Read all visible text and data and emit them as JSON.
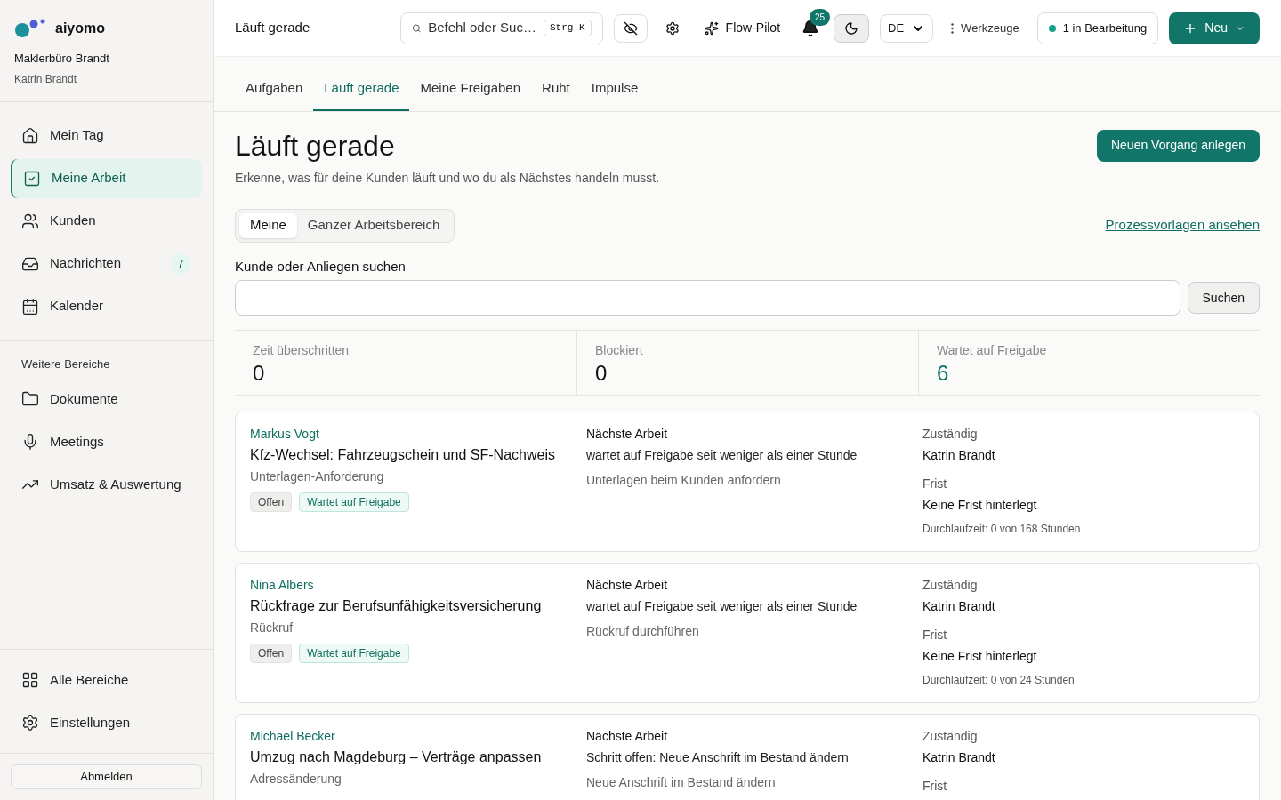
{
  "brand": {
    "name": "aiyomo",
    "office": "Maklerbüro Brandt",
    "user": "Katrin Brandt"
  },
  "nav": [
    {
      "kind": "home",
      "label": "Mein Tag",
      "selected": false
    },
    {
      "kind": "check",
      "label": "Meine Arbeit",
      "selected": true
    },
    {
      "kind": "users",
      "label": "Kunden",
      "selected": false
    },
    {
      "kind": "inbox",
      "label": "Nachrichten",
      "selected": false,
      "badge": "7"
    },
    {
      "kind": "calendar",
      "label": "Kalender",
      "selected": false
    }
  ],
  "more_title": "Weitere Bereiche",
  "more_nav": [
    {
      "kind": "folder",
      "label": "Dokumente",
      "selected": false
    },
    {
      "kind": "mic",
      "label": "Meetings",
      "selected": false
    },
    {
      "kind": "trend",
      "label": "Umsatz & Auswertung",
      "selected": false
    }
  ],
  "bottom_nav": [
    {
      "kind": "grid",
      "label": "Alle Bereiche"
    },
    {
      "kind": "gear",
      "label": "Einstellungen"
    }
  ],
  "logout": "Abmelden",
  "topbar": {
    "title": "Läuft gerade",
    "search_placeholder": "Befehl oder Suc…",
    "shortcut": "Strg K",
    "pilot": "Flow-Pilot",
    "notifications": "25",
    "language": "DE",
    "tools": "Werkzeuge",
    "status": "1 in Bearbeitung",
    "new": "Neu"
  },
  "tabs": [
    {
      "label": "Aufgaben",
      "selected": false
    },
    {
      "label": "Läuft gerade",
      "selected": true
    },
    {
      "label": "Meine Freigaben",
      "selected": false
    },
    {
      "label": "Ruht",
      "selected": false
    },
    {
      "label": "Impulse",
      "selected": false
    }
  ],
  "page": {
    "title": "Läuft gerade",
    "subtitle": "Erkenne, was für deine Kunden läuft und wo du als Nächstes handeln musst.",
    "action": "Neuen Vorgang anlegen",
    "templates_link": "Prozessvorlagen ansehen"
  },
  "scope": [
    {
      "label": "Meine",
      "selected": true
    },
    {
      "label": "Ganzer Arbeitsbereich",
      "selected": false
    }
  ],
  "search": {
    "label": "Kunde oder Anliegen suchen",
    "button": "Suchen"
  },
  "stats": [
    {
      "label": "Zeit überschritten",
      "value": "0",
      "highlight": false
    },
    {
      "label": "Blockiert",
      "value": "0",
      "highlight": false
    },
    {
      "label": "Wartet auf Freigabe",
      "value": "6",
      "highlight": true
    }
  ],
  "cases": [
    {
      "customer": "Markus Vogt",
      "title": "Kfz-Wechsel: Fahrzeugschein und SF-Nachweis",
      "type": "Unterlagen-Anforderung",
      "tags": [
        {
          "label": "Offen",
          "kind": "neutral"
        },
        {
          "label": "Wartet auf Freigabe",
          "kind": "accent"
        }
      ],
      "next_label": "Nächste Arbeit",
      "next": "wartet auf Freigabe seit weniger als einer Stunde",
      "step": "Unterlagen beim Kunden anfordern",
      "owner_label": "Zuständig",
      "owner": "Katrin Brandt",
      "due_label": "Frist",
      "due": "Keine Frist hinterlegt",
      "duration": "Durchlaufzeit: 0 von 168 Stunden"
    },
    {
      "customer": "Nina Albers",
      "title": "Rückfrage zur Berufsunfähigkeitsversicherung",
      "type": "Rückruf",
      "tags": [
        {
          "label": "Offen",
          "kind": "neutral"
        },
        {
          "label": "Wartet auf Freigabe",
          "kind": "accent"
        }
      ],
      "next_label": "Nächste Arbeit",
      "next": "wartet auf Freigabe seit weniger als einer Stunde",
      "step": "Rückruf durchführen",
      "owner_label": "Zuständig",
      "owner": "Katrin Brandt",
      "due_label": "Frist",
      "due": "Keine Frist hinterlegt",
      "duration": "Durchlaufzeit: 0 von 24 Stunden"
    },
    {
      "customer": "Michael Becker",
      "title": "Umzug nach Magdeburg – Verträge anpassen",
      "type": "Adressänderung",
      "next_label": "Nächste Arbeit",
      "next": "Schritt offen: Neue Anschrift im Bestand ändern",
      "step": "Neue Anschrift im Bestand ändern",
      "owner_label": "Zuständig",
      "owner": "Katrin Brandt",
      "due_label": "Frist"
    }
  ]
}
